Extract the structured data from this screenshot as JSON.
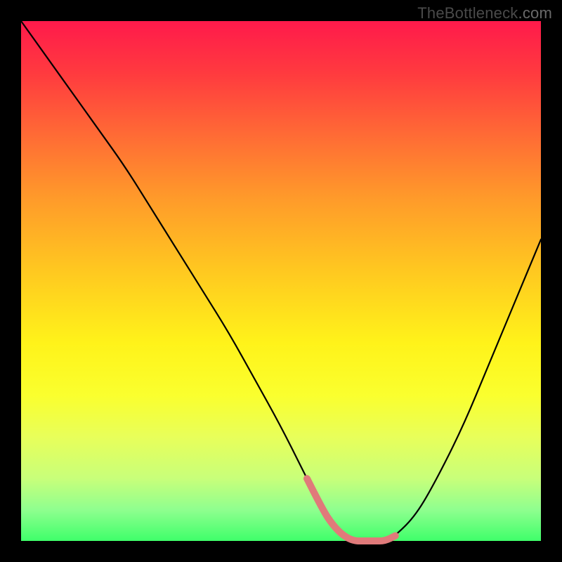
{
  "watermark": {
    "main": "TheBottleneck",
    "suffix": ".com"
  },
  "colors": {
    "background": "#000000",
    "curve_primary": "#000000",
    "curve_accent": "#e07a7a",
    "gradient_top": "#ff1a4b",
    "gradient_bottom": "#3fff6a"
  },
  "chart_data": {
    "type": "line",
    "title": "",
    "xlabel": "",
    "ylabel": "",
    "xlim": [
      0,
      100
    ],
    "ylim": [
      0,
      100
    ],
    "grid": false,
    "series": [
      {
        "name": "bottleneck-curve",
        "x": [
          0,
          5,
          10,
          15,
          20,
          25,
          30,
          35,
          40,
          45,
          50,
          55,
          58,
          60,
          62,
          64,
          66,
          68,
          70,
          72,
          76,
          80,
          85,
          90,
          95,
          100
        ],
        "values": [
          100,
          93,
          86,
          79,
          72,
          64,
          56,
          48,
          40,
          31,
          22,
          12,
          6,
          3,
          1,
          0,
          0,
          0,
          0,
          1,
          5,
          12,
          22,
          34,
          46,
          58
        ]
      }
    ],
    "accent_segment": {
      "x_start": 55,
      "x_end": 72
    },
    "note": "Values estimated from pixel positions; y=0 is bottom (green), y=100 is top (red)."
  }
}
